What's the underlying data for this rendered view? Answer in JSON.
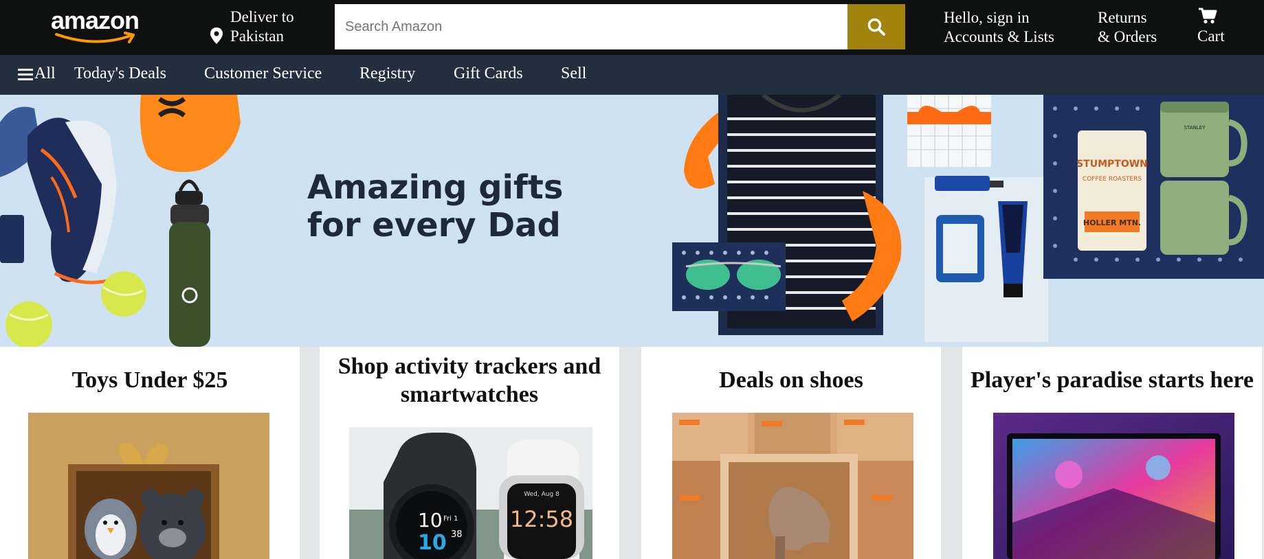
{
  "header": {
    "logo_text": "amazon",
    "deliver_line1": "Deliver to",
    "deliver_line2": "Pakistan",
    "search_placeholder": "Search Amazon",
    "account_line1": "Hello, sign in",
    "account_line2": "Accounts & Lists",
    "returns_line1": "Returns",
    "returns_line2": "& Orders",
    "cart_label": "Cart"
  },
  "nav": {
    "all_label": "All",
    "items": [
      "Today's Deals",
      "Customer Service",
      "Registry",
      "Gift Cards",
      "Sell"
    ]
  },
  "hero": {
    "line1": "Amazing gifts",
    "line2": "for every Dad"
  },
  "cards": [
    {
      "title": "Toys Under $25"
    },
    {
      "title": "Shop activity trackers and smartwatches"
    },
    {
      "title": "Deals on shoes"
    },
    {
      "title": "Player's paradise starts here"
    }
  ],
  "product_text": {
    "watch1_time": "10",
    "watch1_sub": "38",
    "watch1_day": "Fri 1",
    "watch2_date": "Wed, Aug 8",
    "watch2_time": "12:58",
    "coffee_brand": "STUMPTOWN",
    "coffee_line": "COFFEE ROASTERS",
    "coffee_label": "HOLLER MTN.",
    "mug_brand": "STANLEY"
  },
  "colors": {
    "topbar": "#0f1111",
    "navbar": "#232f3e",
    "search_button": "#a0840e",
    "hero_bg": "#cfe2f1",
    "smile": "#ff9900"
  }
}
